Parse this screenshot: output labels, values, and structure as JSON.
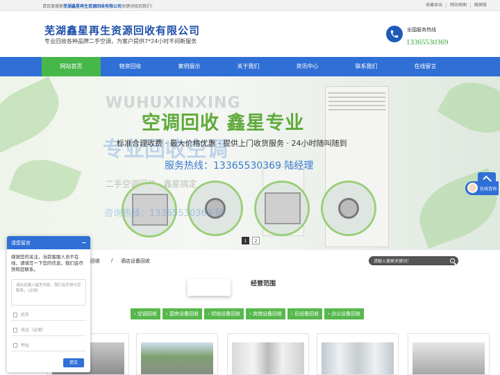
{
  "topbar": {
    "hint_prefix": "请百度搜索",
    "hint_company": "芜湖鑫星再生资源回收有限公司",
    "hint_suffix": "关键词找到我们！",
    "links": [
      "收藏本站",
      "网站地图",
      "触屏版"
    ]
  },
  "header": {
    "company": "芜湖鑫星再生资源回收有限公司",
    "slogan": "专业回收各种品牌二手空调，为客户提供7*24小时不间断服务",
    "hotline_label": "全国服务热线",
    "hotline_number": "13365530369"
  },
  "nav": {
    "items": [
      "网站首页",
      "物资回收",
      "案例展示",
      "关于我们",
      "资讯中心",
      "联系我们",
      "在线留言"
    ],
    "active_index": 0
  },
  "banner": {
    "watermark": "WUHUXINXING",
    "title": "空调回收 鑫星专业",
    "subtitle": "标准合理收费 · 最大价格优惠 · 提供上门收货服务 · 24小时随叫随到",
    "ghost_text": "专业回收空调",
    "service_line": "服务热线：13365530369 陆经理",
    "ghost_text2": "二手空调回收 · 鑫星搞定",
    "ghost_text3": "咨询热线：13365530369 陆",
    "pages": [
      "1",
      "2"
    ],
    "active_page": 0
  },
  "float": {
    "consult_label": "在线咨询"
  },
  "breadcrumb": {
    "items": [
      "回收",
      "/",
      "酒店设备回收"
    ]
  },
  "search": {
    "placeholder": "请输入搜索关键词！"
  },
  "scope": {
    "title": "经营范围",
    "categories": [
      "空调回收",
      "厨房设备回收",
      "烘焙设备回收",
      "宾馆设备回收",
      "旧设备回收",
      "办公设备回收"
    ]
  },
  "chat": {
    "title": "请您留言",
    "message": "感谢您的关注，当前客服人员不在线，请填写一下您的信息，我们会尽快和您联系。",
    "textarea_placeholder": "请在此输入留言内容，我们会尽快与您联系。（必填）",
    "name_placeholder": "姓名",
    "phone_placeholder": "电话（必填）",
    "address_placeholder": "地址",
    "submit": "提交"
  },
  "colors": {
    "nav_blue": "#2f6fd6",
    "accent_green": "#46b84a",
    "brand_blue": "#1e4fa8",
    "hotline_green": "#3aa53a"
  }
}
